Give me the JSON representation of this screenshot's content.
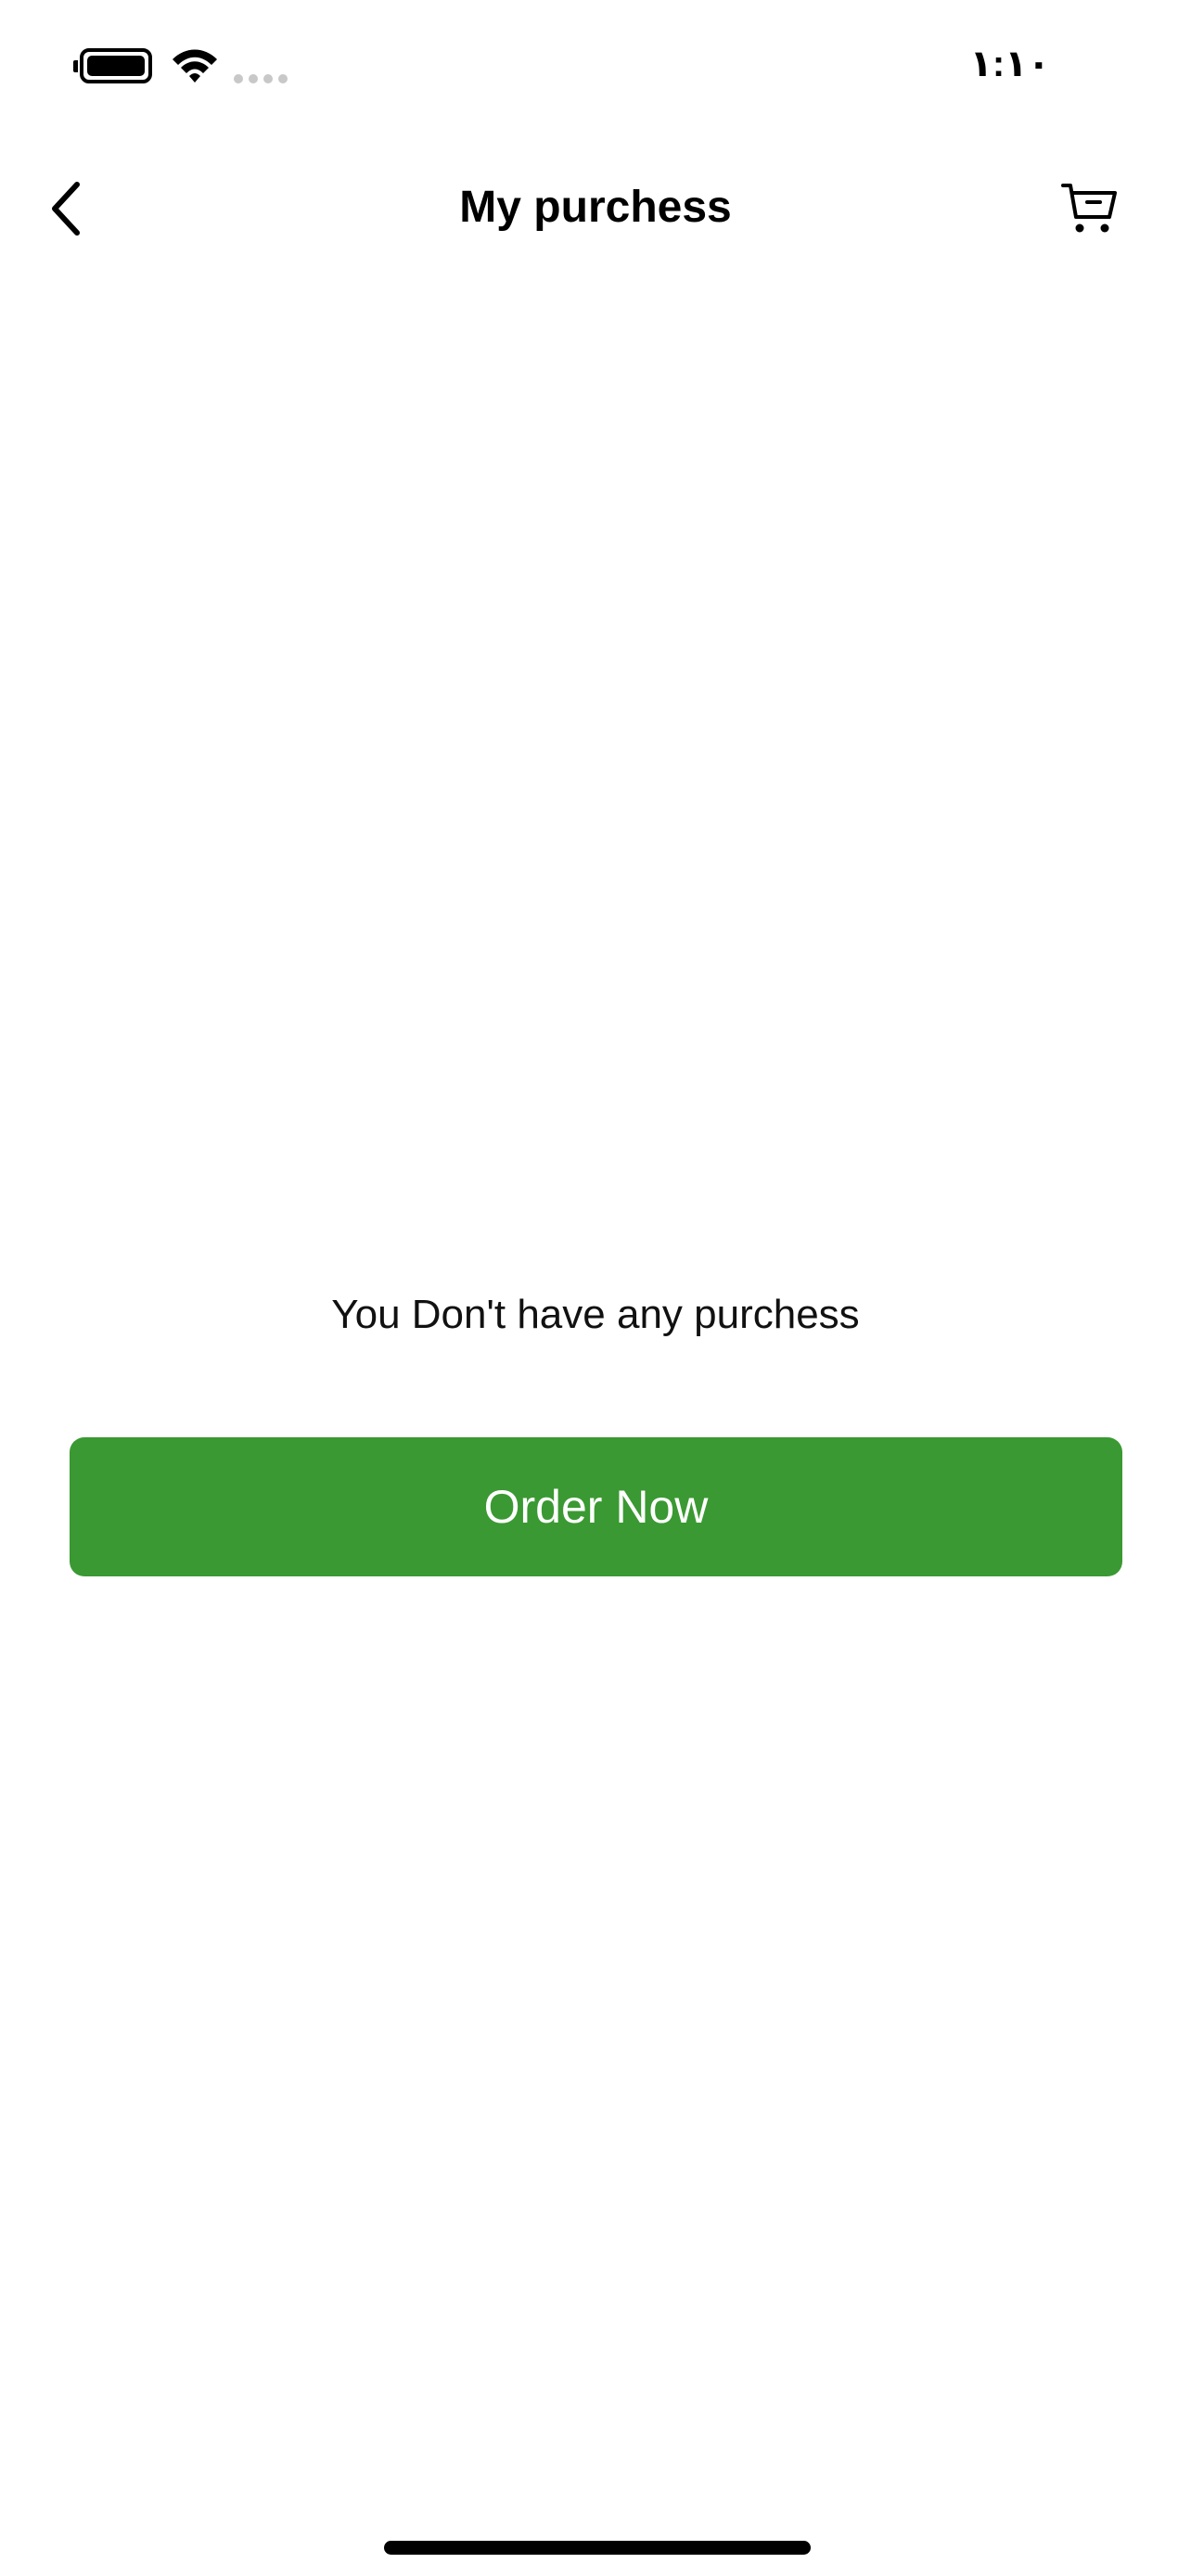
{
  "status_bar": {
    "time": "١:١٠"
  },
  "header": {
    "title": "My purchess"
  },
  "empty_state": {
    "message": "You Don't have any purchess",
    "button_label": "Order Now"
  },
  "colors": {
    "accent": "#3a9932",
    "background": "#ffffff",
    "text": "#000000"
  },
  "icons": {
    "back": "chevron-left-icon",
    "cart": "cart-icon",
    "battery": "battery-icon",
    "wifi": "wifi-icon",
    "signal": "cellular-signal-icon"
  }
}
